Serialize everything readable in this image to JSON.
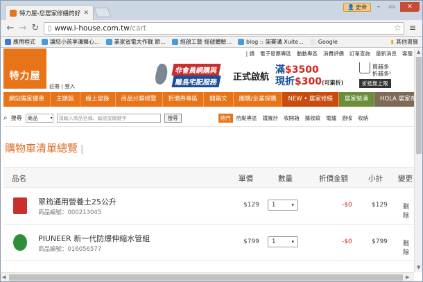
{
  "browser": {
    "tab_title": "特力屋-您居家修繕的好幫手",
    "url_host": "www.i-house.com.tw",
    "url_path": "/cart",
    "profile_label": "史帝",
    "bookmarks": [
      {
        "label": "應用程式",
        "color": "#3b7bd6"
      },
      {
        "label": "讓您小孩享溝聲心...",
        "color": "#4a9ad8"
      },
      {
        "label": "業家省電大作戰 節...",
        "color": "#4a9ad8"
      },
      {
        "label": "經啟工藝 經啟體驗...",
        "color": "#4a9ad8"
      },
      {
        "label": "blog :: 諾賽溝 Xuite...",
        "color": "#4a9ad8"
      },
      {
        "label": "Google",
        "color": "#e8e8e8"
      }
    ],
    "bookmarks_more": "其他書籤"
  },
  "site": {
    "logo_text": "特力屋",
    "account_links": "註冊 | 登入",
    "top_links": [
      "| 讀",
      "電子發票專區",
      "動動專區",
      "消費評價",
      "訂單查詢",
      "最新消息",
      "客服"
    ],
    "banner": {
      "line1": "非會員網購與",
      "line2": "離島宅配服務",
      "start": "正式啟航",
      "promo1_a": "滿",
      "promo1_b": "$3500",
      "promo2_a": "現折",
      "promo2_b": "$300",
      "promo2_note": "(可累折)",
      "gift_line1": "買越多",
      "gift_line2": "折越多!",
      "gift_tag": "折抵無上限"
    },
    "main_nav": [
      "網站獨家優惠",
      "主題館",
      "線上型錄",
      "商品分類總覽",
      "折價券專區",
      "開箱文",
      "團購/企業採購",
      "NEW • 居家修繕",
      "居家裝潢",
      "HOLA 居家布置"
    ],
    "search": {
      "label": "搜尋",
      "scope": "商品",
      "placeholder": "請輸入商品名稱、編號或關鍵字",
      "button": "搜尋",
      "hot_label": "熱門",
      "hot_items": [
        "防颱專區",
        "鐵置計",
        "收開箱",
        "攜收縱",
        "電爐",
        "廚收",
        "收納"
      ]
    }
  },
  "cart": {
    "title": "購物車清單總覽",
    "columns": {
      "name": "品名",
      "price": "單價",
      "qty": "數量",
      "discount": "折價金額",
      "subtotal": "小計",
      "action": "變更"
    },
    "items": [
      {
        "name": "翠筠通用營養土25公升",
        "code": "商品編號：000213045",
        "price": "$129",
        "qty": "1",
        "discount": "-$0",
        "subtotal": "$129",
        "action": "刪除",
        "img_color": "#c8302d"
      },
      {
        "name": "PIUNEER 新一代防爆伸縮水管組",
        "code": "商品編號：016056577",
        "price": "$799",
        "qty": "1",
        "discount": "-$0",
        "subtotal": "$799",
        "action": "刪除",
        "img_color": "#2d8f3a"
      }
    ]
  }
}
